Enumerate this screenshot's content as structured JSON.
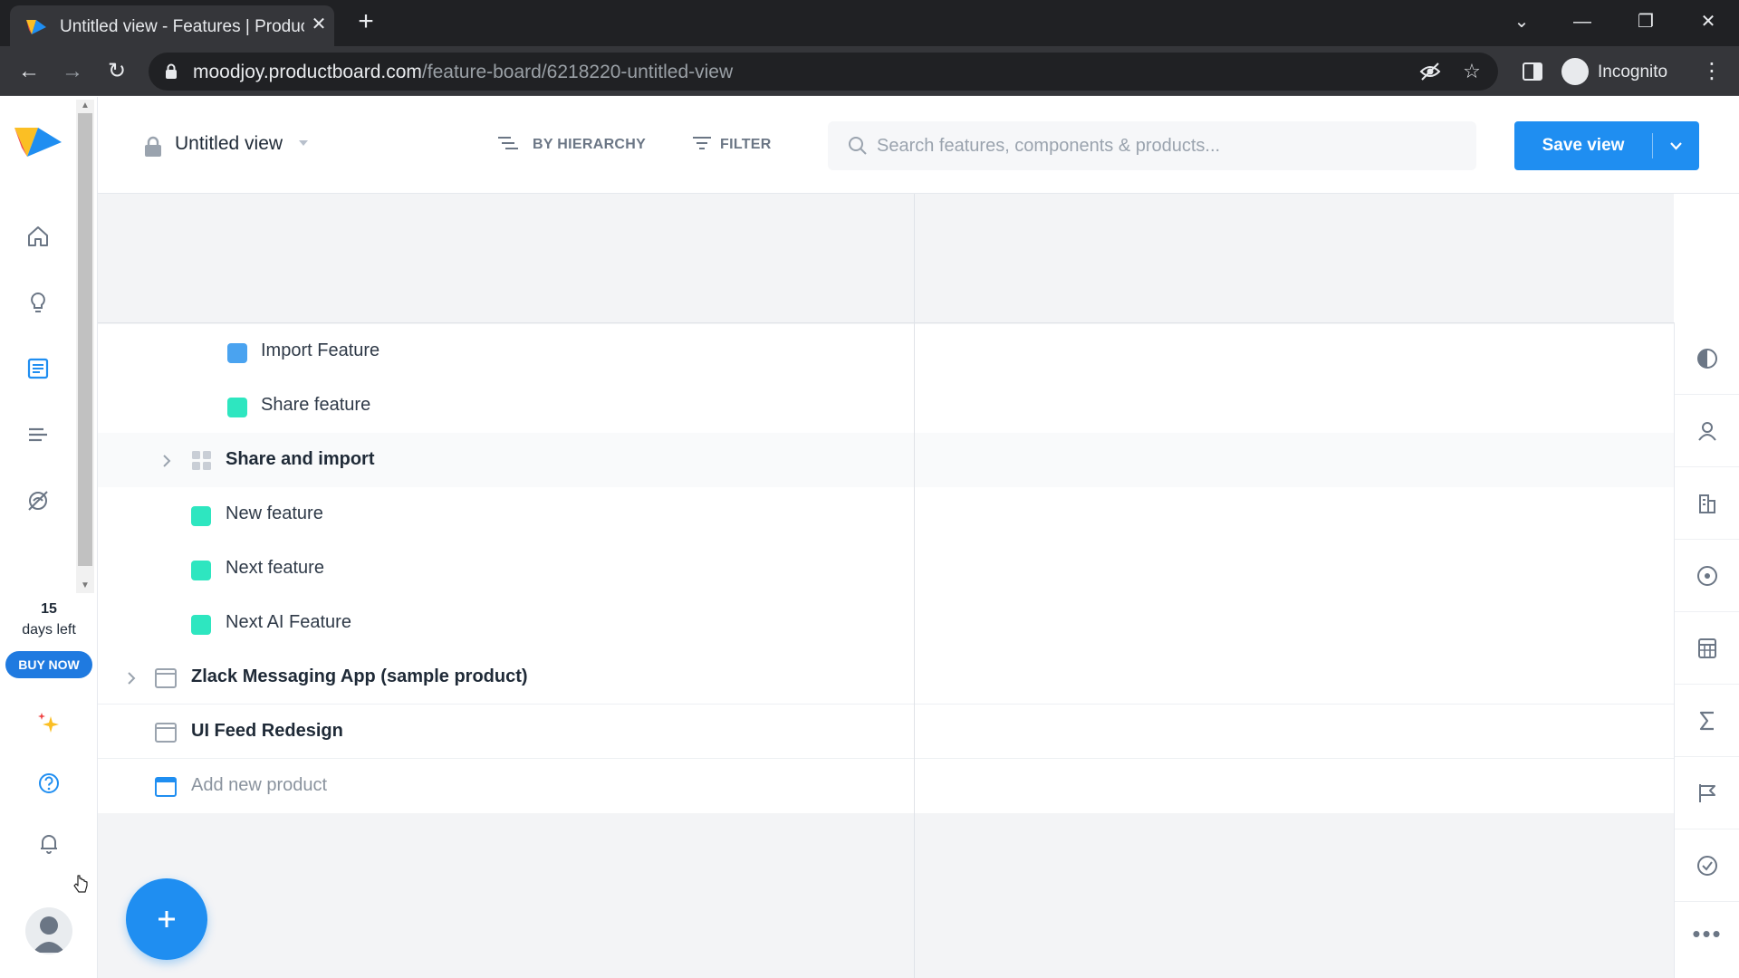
{
  "browser": {
    "tab_title": "Untitled view - Features | Productboard",
    "new_tab_icon": "plus-icon",
    "url_host": "moodjoy.productboard.com",
    "url_path": "/feature-board/6218220-untitled-view",
    "incognito_label": "Incognito"
  },
  "rail": {
    "trial_days": "15",
    "trial_text": "days left",
    "buy_now": "BUY NOW",
    "icons": [
      "home-icon",
      "insights-bulb-icon",
      "features-board-icon",
      "roadmap-icon",
      "portal-icon",
      "sparkle-icon",
      "help-icon",
      "bell-icon"
    ]
  },
  "header": {
    "view_title": "Untitled view",
    "group_by": "BY HIERARCHY",
    "filter": "FILTER",
    "search_placeholder": "Search features, components & products...",
    "save_view": "Save view"
  },
  "board": {
    "rows": [
      {
        "label": "Import Feature",
        "type": "feature",
        "color": "#4aa3f0"
      },
      {
        "label": "Share feature",
        "type": "feature",
        "color": "#2ee6c0"
      },
      {
        "label": "Share and import",
        "type": "component"
      },
      {
        "label": "New feature",
        "type": "feature",
        "color": "#2ee6c0"
      },
      {
        "label": "Next feature",
        "type": "feature",
        "color": "#2ee6c0"
      },
      {
        "label": "Next AI Feature",
        "type": "feature",
        "color": "#2ee6c0"
      },
      {
        "label": "Zlack Messaging App (sample product)",
        "type": "product"
      },
      {
        "label": "UI Feed Redesign",
        "type": "product"
      },
      {
        "label": "Add new product",
        "type": "add"
      }
    ],
    "fab_icon": "plus-icon"
  },
  "right_rail": {
    "icons": [
      "pie-chart-icon",
      "user-icon",
      "company-icon",
      "target-icon",
      "calculator-icon",
      "sigma-icon",
      "flag-icon",
      "check-circle-icon",
      "more-icon"
    ]
  },
  "colors": {
    "accent": "#1f8ef1",
    "feature_teal": "#2ee6c0",
    "feature_blue": "#4aa3f0"
  }
}
